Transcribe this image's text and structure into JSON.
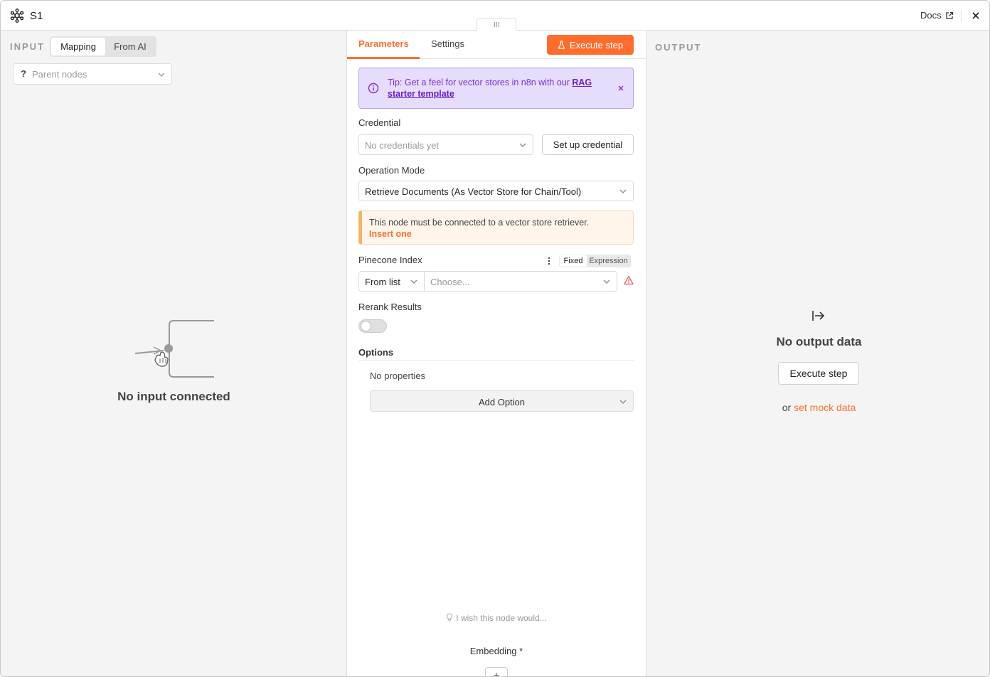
{
  "header": {
    "title": "S1",
    "docs_label": "Docs"
  },
  "input_panel": {
    "label": "INPUT",
    "mode_tabs": [
      "Mapping",
      "From AI"
    ],
    "parent_select": {
      "icon_text": "?",
      "placeholder": "Parent nodes"
    },
    "empty_text": "No input connected"
  },
  "params_panel": {
    "tabs": [
      "Parameters",
      "Settings"
    ],
    "execute_label": "Execute step",
    "tip": {
      "text": "Tip: Get a feel for vector stores in n8n with our ",
      "link": "RAG starter template"
    },
    "credential": {
      "label": "Credential",
      "placeholder": "No credentials yet",
      "button": "Set up credential"
    },
    "operation_mode": {
      "label": "Operation Mode",
      "value": "Retrieve Documents (As Vector Store for Chain/Tool)"
    },
    "warning": {
      "text": "This node must be connected to a vector store retriever.",
      "link": "Insert one"
    },
    "pinecone_index": {
      "label": "Pinecone Index",
      "toggle": [
        "Fixed",
        "Expression"
      ],
      "mode_value": "From list",
      "placeholder": "Choose..."
    },
    "rerank": {
      "label": "Rerank Results",
      "enabled": false
    },
    "options": {
      "label": "Options",
      "empty_text": "No properties",
      "add_label": "Add Option"
    },
    "wish_text": "I wish this node would...",
    "embedding_label": "Embedding *",
    "plus_label": "+"
  },
  "output_panel": {
    "label": "OUTPUT",
    "empty_text": "No output data",
    "execute_label": "Execute step",
    "mock_prefix": "or ",
    "mock_link": "set mock data"
  },
  "colors": {
    "accent": "#ff6d2d",
    "tip_bg": "#e6dcfb",
    "tip_text": "#7c2fd6",
    "warning_border": "#f3b565",
    "error": "#e8505b"
  }
}
